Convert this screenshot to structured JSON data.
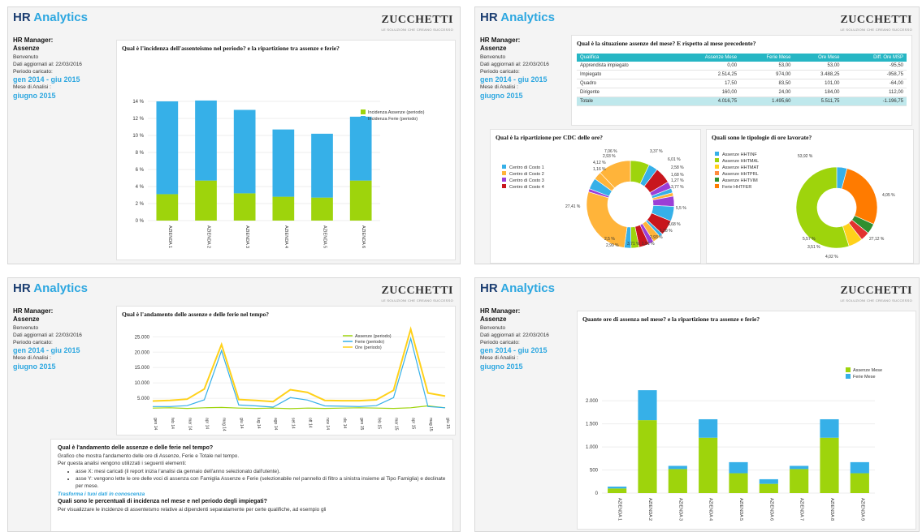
{
  "header": {
    "title_main": "HR",
    "title_accent": "Analytics"
  },
  "logo": {
    "name": "ZUCCHETTI",
    "tagline": "LE SOLUZIONI CHE CREANO SUCCESSO"
  },
  "sidebar": {
    "role_prefix": "HR Manager:",
    "role": "Assenze",
    "welcome": "Benvenuto",
    "updated": "Dati aggiornati al: 22/03/2016",
    "period_label": "Periodo caricato:",
    "period": "gen 2014 - giu 2015",
    "month_label": "Mese di Analisi :",
    "month": "giugno 2015"
  },
  "colors": {
    "green": "#9ed40c",
    "blue": "#36b0e8",
    "yellow": "#ffd11a",
    "accent": "#2da7e0",
    "navy": "#1d3f72",
    "teal": "#26b6c4"
  },
  "chart_data": [
    {
      "id": "incidenza",
      "type": "bar",
      "title": "Qual è l'incidenza dell'assenteismo nel periodo? e la ripartizione tra assenze e ferie?",
      "categories": [
        "AZIENDA 1",
        "AZIENDA 2",
        "AZIENDA 3",
        "AZIENDA 4",
        "AZIENDA 5",
        "AZIENDA 6"
      ],
      "series": [
        {
          "name": "Incidenza Assenze (periodo)",
          "color": "#9ed40c",
          "values": [
            3.1,
            4.7,
            3.2,
            2.8,
            2.7,
            4.7
          ]
        },
        {
          "name": "Incidenza Ferie (periodo)",
          "color": "#36b0e8",
          "values": [
            10.9,
            9.4,
            9.8,
            7.9,
            7.5,
            7.5
          ]
        }
      ],
      "stacked": true,
      "ylim": [
        0,
        14
      ],
      "yticks": [
        "0 %",
        "2 %",
        "4 %",
        "6 %",
        "8 %",
        "10 %",
        "12 %",
        "14 %"
      ],
      "legend": "top-right"
    },
    {
      "id": "cdc",
      "type": "pie",
      "title": "Qual è la ripartizione per CDC delle ore?",
      "legend_entries": [
        {
          "label": "Centro di Costo 1",
          "color": "#36b0e8"
        },
        {
          "label": "Centro di Costo 2",
          "color": "#ffb43a"
        },
        {
          "label": "Centro di Costo 3",
          "color": "#9b3fd6"
        },
        {
          "label": "Centro di Costo 4",
          "color": "#c8161d"
        }
      ],
      "labels": [
        "7,06 %",
        "3,37 %",
        "6,01 %",
        "2,58 %",
        "1,68 %",
        "1,27 %",
        "3,77 %",
        "5,5 %",
        "5,68 %",
        "1,28 %",
        "2,93 %",
        "1,91 %",
        "3,71 %",
        "2,99 %",
        "2,5 %",
        "27,41 %",
        "1,16 %",
        "4,12 %",
        "2,93 %"
      ]
    },
    {
      "id": "tipologie",
      "type": "pie",
      "title": "Quali sono le tipologie di ore lavorate?",
      "legend_entries": [
        {
          "label": "Assenze HHTINF",
          "color": "#36b0e8"
        },
        {
          "label": "Assenze HHTMAL",
          "color": "#9ed40c"
        },
        {
          "label": "Assenze HHTMAT",
          "color": "#ffd11a"
        },
        {
          "label": "Assenze HHTPRL",
          "color": "#ff8a3d"
        },
        {
          "label": "Assenze HHTVIM",
          "color": "#2f8f2f"
        },
        {
          "label": "Ferie HHTFER",
          "color": "#ff7b00"
        }
      ],
      "slices": [
        {
          "label": "4,05 %",
          "value": 4.05,
          "color": "#36b0e8"
        },
        {
          "label": "27,12 %",
          "value": 27.12,
          "color": "#ff7b00"
        },
        {
          "label": "4,02 %",
          "value": 4.02,
          "color": "#2f8f2f"
        },
        {
          "label": "3,51 %",
          "value": 3.51,
          "color": "#e2322f"
        },
        {
          "label": "5,57 %",
          "value": 5.57,
          "color": "#ffd11a"
        },
        {
          "label": "53,92 %",
          "value": 53.92,
          "color": "#9ed40c"
        }
      ]
    },
    {
      "id": "andamento",
      "type": "line",
      "title": "Qual è l'andamento delle assenze e delle ferie nel tempo?",
      "categories": [
        "gen 14",
        "feb 14",
        "mar 14",
        "apr 14",
        "mag 14",
        "giu 14",
        "lug 14",
        "ago 14",
        "set 14",
        "ott 14",
        "nov 14",
        "dic 14",
        "gen 15",
        "feb 15",
        "mar 15",
        "apr 15",
        "mag 15",
        "giu 15"
      ],
      "series": [
        {
          "name": "Assenze (periodo)",
          "color": "#9ed40c",
          "values": [
            1800,
            1900,
            1700,
            1900,
            2000,
            1800,
            1700,
            1800,
            1600,
            1800,
            1700,
            1800,
            1900,
            1800,
            1700,
            1900,
            2500,
            1900
          ]
        },
        {
          "name": "Ferie (periodo)",
          "color": "#36b0e8",
          "values": [
            2300,
            2300,
            2600,
            4500,
            20500,
            2800,
            2500,
            2100,
            5200,
            4400,
            2500,
            2400,
            2300,
            2600,
            5200,
            24500,
            2300,
            1900
          ]
        },
        {
          "name": "Ore (periodo)",
          "color": "#ffd11a",
          "values": [
            4100,
            4300,
            4700,
            8000,
            22500,
            4600,
            4300,
            3900,
            7800,
            6900,
            4300,
            4200,
            4200,
            4500,
            7600,
            27500,
            6700,
            5700
          ]
        }
      ],
      "ylim": [
        0,
        28000
      ],
      "yticks": [
        "5.000",
        "10.000",
        "15.000",
        "20.000",
        "25.000"
      ],
      "legend": "top-right"
    },
    {
      "id": "ore_mese",
      "type": "bar",
      "title": "Quante ore di assenza nel mese? e la ripartizione tra assenze e ferie?",
      "categories": [
        "AZIENDA 1",
        "AZIENDA 2",
        "AZIENDA 3",
        "AZIENDA 4",
        "AZIENDA 5",
        "AZIENDA 6",
        "AZIENDA 7",
        "AZIENDA 8",
        "AZIENDA 9"
      ],
      "series": [
        {
          "name": "Assenze Mese",
          "color": "#9ed40c",
          "values": [
            100,
            1580,
            520,
            1200,
            430,
            200,
            520,
            1200,
            430
          ]
        },
        {
          "name": "Ferie Mese",
          "color": "#36b0e8",
          "values": [
            40,
            650,
            70,
            400,
            240,
            100,
            70,
            400,
            240
          ]
        }
      ],
      "stacked": true,
      "ylim": [
        0,
        2250
      ],
      "yticks": [
        "0",
        "500",
        "1.000",
        "1.500",
        "2.000"
      ],
      "legend": "top-right"
    }
  ],
  "situazione": {
    "title": "Qual è la situazione assenze del mese? E rispetto al mese precedente?",
    "columns": [
      "Qualifica",
      "Assenze Mese",
      "Ferie Mese",
      "Ore Mese",
      "Diff. Ore MSP"
    ],
    "rows": [
      [
        "Apprendista impiegato",
        "0,00",
        "53,00",
        "53,00",
        "-95,50"
      ],
      [
        "Impiegato",
        "2.514,25",
        "974,00",
        "3.488,25",
        "-958,75"
      ],
      [
        "Quadro",
        "17,50",
        "83,50",
        "101,00",
        "-64,00"
      ],
      [
        "Dirigente",
        "160,00",
        "24,00",
        "184,00",
        "112,00"
      ]
    ],
    "total": [
      "Totale",
      "4.016,75",
      "1.495,60",
      "5.511,75",
      "-1.196,75"
    ]
  },
  "descrizione": {
    "heading": "Qual è l'andamento delle assenze e delle ferie nel tempo?",
    "line1": "Grafico che mostra l'andamento delle ore di Assenze, Ferie e Totale nel tempo.",
    "line2": "Per questa analisi vengono utilizzati i seguenti elementi:",
    "bullet1": "asse X: mesi caricati (il report inizia l'analisi da gennaio dell'anno selezionato dall'utente).",
    "bullet2": "asse Y: vengono lette le ore delle voci di assenza con Famiglia Assenze e Ferie (selezionabile nel pannello di filtro a sinistra insieme al Tipo Famiglia) e declinate per mese.",
    "slogan": "Trasforma i tuoi dati in conoscenza",
    "heading2": "Quali sono le percentuali di incidenza nel mese e nel periodo degli impiegati?",
    "line3": "Per visualizzare le incidenze di assenteismo relative ai dipendenti separatamente per certe qualifiche, ad esempio gli"
  }
}
